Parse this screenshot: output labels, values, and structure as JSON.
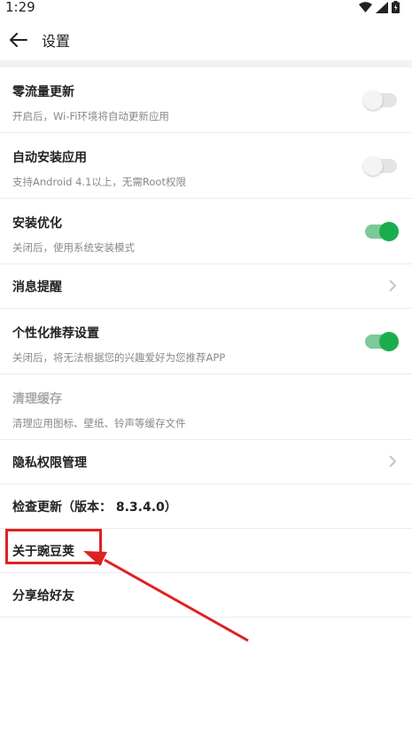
{
  "status_bar": {
    "time": "1:29",
    "icons": [
      "wifi-icon",
      "signal-icon",
      "battery-icon"
    ]
  },
  "header": {
    "back_icon": "back-arrow-icon",
    "title": "设置"
  },
  "settings": [
    {
      "id": "zero-traffic-update",
      "title": "零流量更新",
      "subtitle": "开启后，Wi-Fi环境将自动更新应用",
      "control": "toggle",
      "on": false
    },
    {
      "id": "auto-install",
      "title": "自动安装应用",
      "subtitle": "支持Android 4.1以上，无需Root权限",
      "control": "toggle",
      "on": false
    },
    {
      "id": "install-optimize",
      "title": "安装优化",
      "subtitle": "关闭后，使用系统安装模式",
      "control": "toggle",
      "on": true
    },
    {
      "id": "message-reminder",
      "title": "消息提醒",
      "control": "chevron"
    },
    {
      "id": "personalized-recommend",
      "title": "个性化推荐设置",
      "subtitle": "关闭后，将无法根据您的兴趣爱好为您推荐APP",
      "control": "toggle",
      "on": true
    },
    {
      "id": "clear-cache",
      "title": "清理缓存",
      "subtitle": "清理应用图标、壁纸、铃声等缓存文件",
      "disabled": true
    },
    {
      "id": "privacy-permission",
      "title": "隐私权限管理",
      "control": "chevron"
    },
    {
      "id": "check-update",
      "title": "检查更新（版本： 8.3.4.0）"
    },
    {
      "id": "about",
      "title": "关于豌豆荚"
    },
    {
      "id": "share",
      "title": "分享给好友"
    }
  ],
  "colors": {
    "toggle_on": "#1aad4e",
    "toggle_on_track": "#7cc99a",
    "toggle_off_track": "#e4e4e4",
    "annotation": "#e02020"
  }
}
